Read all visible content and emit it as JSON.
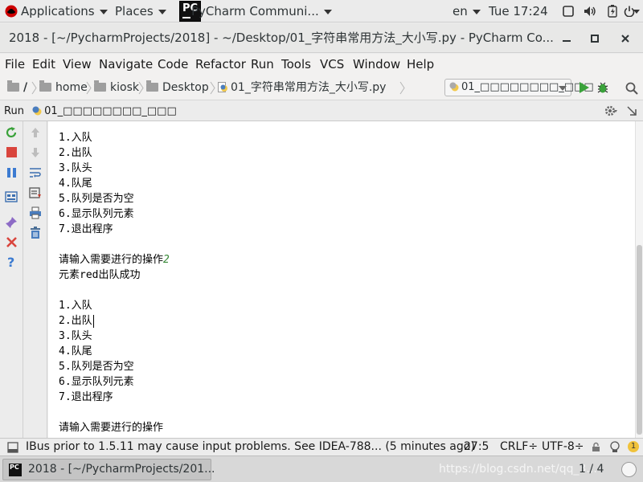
{
  "topbar": {
    "applications": "Applications",
    "places": "Places",
    "active_app": "PyCharm Communi...",
    "input_lang": "en",
    "clock": "Tue 17:24"
  },
  "window": {
    "title": "2018 - [~/PycharmProjects/2018] - ~/Desktop/01_字符串常用方法_大小写.py - PyCharm Co..."
  },
  "menu": {
    "items": [
      "File",
      "Edit",
      "View",
      "Navigate",
      "Code",
      "Refactor",
      "Run",
      "Tools",
      "VCS",
      "Window",
      "Help"
    ]
  },
  "navbar": {
    "breadcrumbs": [
      "/",
      "home",
      "kiosk",
      "Desktop",
      "01_字符串常用方法_大小写.py"
    ],
    "run_config": "01_□□□□□□□□_□□□"
  },
  "run_panel": {
    "label": "Run",
    "config_name": "01_□□□□□□□□_□□□"
  },
  "console": {
    "lines": [
      {
        "text": "1.入队"
      },
      {
        "text": "2.出队"
      },
      {
        "text": "3.队头"
      },
      {
        "text": "4.队尾"
      },
      {
        "text": "5.队列是否为空"
      },
      {
        "text": "6.显示队列元素"
      },
      {
        "text": "7.退出程序"
      },
      {
        "text": ""
      },
      {
        "text": "请输入需要进行的操作",
        "input": "2"
      },
      {
        "text": "元素red出队成功"
      },
      {
        "text": ""
      },
      {
        "text": "1.入队"
      },
      {
        "text": "2.出队",
        "caret": true
      },
      {
        "text": "3.队头"
      },
      {
        "text": "4.队尾"
      },
      {
        "text": "5.队列是否为空"
      },
      {
        "text": "6.显示队列元素"
      },
      {
        "text": "7.退出程序"
      },
      {
        "text": ""
      },
      {
        "text": "请输入需要进行的操作"
      }
    ]
  },
  "statusbar": {
    "message": "IBus prior to 1.5.11 may cause input problems. See IDEA-788... (5 minutes ago)",
    "position": "27:5",
    "line_sep": "CRLF÷",
    "encoding": "UTF-8÷",
    "notifications": "1"
  },
  "taskbar": {
    "task_label": "2018 - [~/PycharmProjects/201...",
    "watermark": "https://blog.csdn.net/qq_3...",
    "pager": "1 / 4"
  },
  "colors": {
    "run_green": "#3aa23a",
    "stop_red": "#d9453d",
    "pause_blue": "#3c7bd1",
    "user_input_green": "#3a8a3a"
  }
}
